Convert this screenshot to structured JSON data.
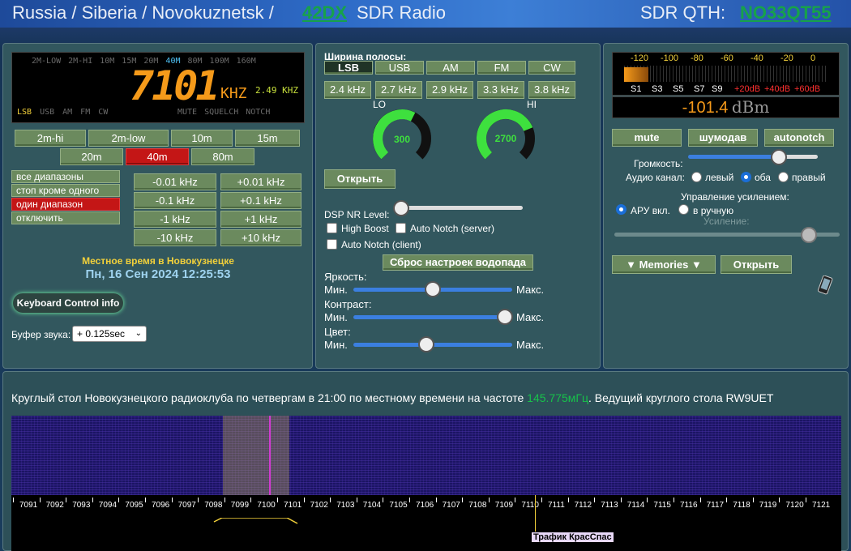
{
  "header": {
    "location": "Russia / Siberia / Novokuznetsk /",
    "site_link": "42DX",
    "app_title": "SDR Radio",
    "qth_label": "SDR QTH:",
    "qth_value": "NO33QT55"
  },
  "display": {
    "bands": [
      "2M-LOW",
      "2M-HI",
      "10M",
      "15M",
      "20M",
      "40M",
      "80M",
      "100M",
      "160M"
    ],
    "active_band": "40M",
    "frequency": "7101",
    "unit": "KHZ",
    "bandwidth": "2.49 KHZ",
    "modes": [
      "LSB",
      "USB",
      "AM",
      "FM",
      "CW"
    ],
    "flags": [
      "MUTE",
      "SQUELCH",
      "NOTCH"
    ]
  },
  "band_buttons": [
    "2m-hi",
    "2m-low",
    "10m",
    "15m",
    "20m",
    "40m",
    "80m"
  ],
  "scan_modes": [
    "все диапазоны",
    "стоп кроме одного",
    "один диапазон",
    "отключить"
  ],
  "step_buttons": [
    "-0.01 kHz",
    "+0.01 kHz",
    "-0.1 kHz",
    "+0.1 kHz",
    "-1 kHz",
    "+1 kHz",
    "-10 kHz",
    "+10 kHz"
  ],
  "local_time_label": "Местное время в Новокузнецке",
  "local_time": "Пн, 16 Сен 2024 12:25:53",
  "keyboard_button": "Keyboard Control info",
  "buffer": {
    "label": "Буфер звука:",
    "value": "+ 0.125sec"
  },
  "bandwidth_panel": {
    "title": "Ширина полосы:",
    "modes": [
      "LSB",
      "USB",
      "AM",
      "FM",
      "CW"
    ],
    "widths": [
      "2.4 kHz",
      "2.7 kHz",
      "2.9 kHz",
      "3.3 kHz",
      "3.8 kHz"
    ],
    "lo_label": "LO",
    "lo_value": "300",
    "lo_level": 0.6,
    "hi_label": "HI",
    "hi_value": "2700",
    "hi_level": 0.75,
    "open_button": "Открыть",
    "dsp_label": "DSP NR Level:",
    "high_boost": "High Boost",
    "auto_notch_server": "Auto Notch (server)",
    "auto_notch_client": "Auto Notch (client)",
    "reset_button": "Сброс настроек водопада",
    "brightness": "Яркость:",
    "contrast": "Контраст:",
    "color": "Цвет:",
    "min": "Мин.",
    "max": "Макс."
  },
  "meter": {
    "scale": [
      "-120",
      "-100",
      "-80",
      "-60",
      "-40",
      "-20",
      "0"
    ],
    "s_units": [
      "S1",
      "S3",
      "S5",
      "S7",
      "S9",
      "+20dB",
      "+40dB",
      "+60dB"
    ],
    "value": "-101.4",
    "unit": "dBm"
  },
  "audio": {
    "buttons": [
      "mute",
      "шумодав",
      "autonotch"
    ],
    "volume_label": "Громкость:",
    "channel_label": "Аудио канал:",
    "channels": [
      "левый",
      "оба",
      "правый"
    ],
    "gain_mgmt": "Управление усилением:",
    "agc_on": "АРУ вкл.",
    "manual": "в ручную",
    "gain": "Усиление:",
    "memories": "▼ Memories ▼",
    "open": "Открыть"
  },
  "notice": {
    "text_before": "Круглый стол Новокузнецкого радиоклуба по четвергам в 21:00 по местному времени на частоте ",
    "freq": "145.775мГц",
    "text_after": ". Ведущий круглого стола RW9UET"
  },
  "waterfall": {
    "ticks": [
      "7091",
      "7092",
      "7093",
      "7094",
      "7095",
      "7096",
      "7097",
      "7098",
      "7099",
      "7100",
      "7101",
      "7102",
      "7103",
      "7104",
      "7105",
      "7106",
      "7107",
      "7108",
      "7109",
      "7110",
      "7111",
      "7112",
      "7113",
      "7114",
      "7115",
      "7116",
      "7117",
      "7118",
      "7119",
      "7120",
      "7121"
    ],
    "marker_label": "Трафик КрасСпас"
  },
  "colors": {
    "accent_orange": "#f59a1a",
    "link_green": "#17a24a",
    "panel": "#32575e"
  }
}
